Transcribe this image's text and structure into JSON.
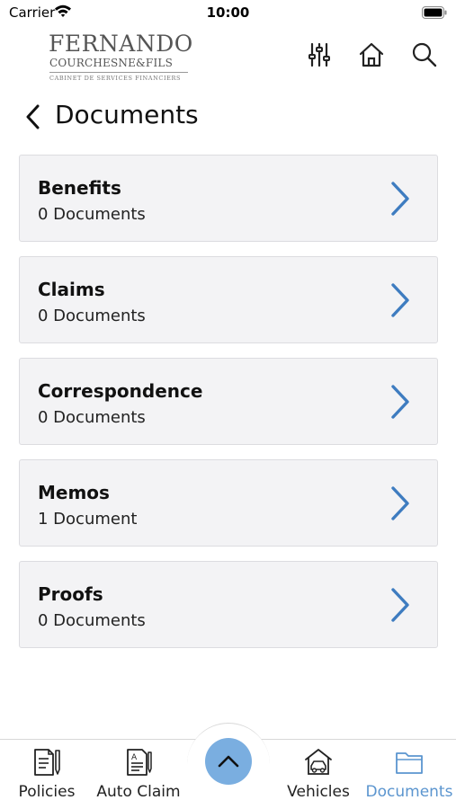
{
  "status_bar": {
    "carrier": "Carrier",
    "time": "10:00"
  },
  "header": {
    "logo": {
      "line1": "FERNANDO",
      "line2": "COURCHESNE&FILS",
      "line3": "CABINET DE SERVICES FINANCIERS"
    },
    "icons": [
      "sliders-icon",
      "home-icon",
      "search-icon"
    ]
  },
  "page": {
    "title": "Documents"
  },
  "folders": [
    {
      "name": "Benefits",
      "count": "0 Documents"
    },
    {
      "name": "Claims",
      "count": "0 Documents"
    },
    {
      "name": "Correspondence",
      "count": "0 Documents"
    },
    {
      "name": "Memos",
      "count": "1 Document"
    },
    {
      "name": "Proofs",
      "count": "0 Documents"
    }
  ],
  "tab_bar": {
    "tabs": [
      {
        "label": "Policies",
        "icon": "policy-document-icon",
        "active": false
      },
      {
        "label": "Auto Claim",
        "icon": "auto-claim-form-icon",
        "active": false
      },
      {
        "label": "Vehicles",
        "icon": "car-garage-icon",
        "active": false
      },
      {
        "label": "Documents",
        "icon": "folder-icon",
        "active": true
      }
    ],
    "center_button_icon": "chevron-up-icon"
  },
  "colors": {
    "accent": "#3e7cc0",
    "active_tab": "#5b95cf",
    "center_button": "#7aaee0",
    "card_background": "#f3f3f5"
  }
}
